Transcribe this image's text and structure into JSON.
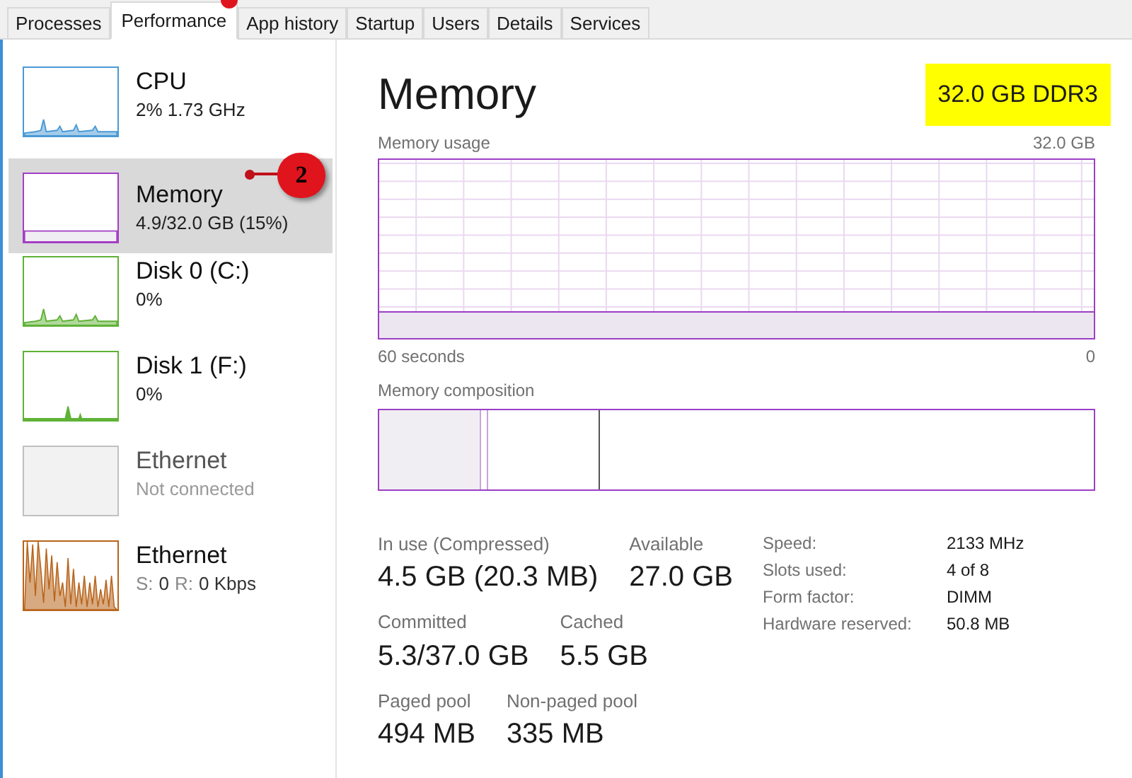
{
  "tabs": [
    {
      "label": "Processes",
      "selected": false
    },
    {
      "label": "Performance",
      "selected": true
    },
    {
      "label": "App history",
      "selected": false
    },
    {
      "label": "Startup",
      "selected": false
    },
    {
      "label": "Users",
      "selected": false
    },
    {
      "label": "Details",
      "selected": false
    },
    {
      "label": "Services",
      "selected": false
    }
  ],
  "sidebar": {
    "items": [
      {
        "kind": "spiky",
        "color": "#4a9ad6",
        "title": "CPU",
        "subtitle": "2% 1.73 GHz",
        "selected": false,
        "disabled": false
      },
      {
        "kind": "flat",
        "color": "#a33fc4",
        "title": "Memory",
        "subtitle": "4.9/32.0 GB (15%)",
        "selected": true,
        "disabled": false
      },
      {
        "kind": "spiky",
        "color": "#5fb236",
        "title": "Disk 0 (C:)",
        "subtitle": "0%",
        "selected": false,
        "disabled": false
      },
      {
        "kind": "single",
        "color": "#5fb236",
        "title": "Disk 1 (F:)",
        "subtitle": "0%",
        "selected": false,
        "disabled": false
      },
      {
        "kind": "empty",
        "color": "#c0c0c0",
        "title": "Ethernet",
        "subtitle": "Not connected",
        "selected": false,
        "disabled": true
      },
      {
        "kind": "dense",
        "color": "#b8641a",
        "title": "Ethernet",
        "details": [
          {
            "label": "S:",
            "value": "0"
          },
          {
            "label": "R:",
            "value": "0 Kbps"
          }
        ],
        "selected": false,
        "disabled": false
      }
    ]
  },
  "annotation": {
    "label": "2"
  },
  "panel": {
    "title": "Memory",
    "badge": "32.0 GB DDR3",
    "usage_graph": {
      "label": "Memory usage",
      "max": "32.0 GB",
      "time": "60 seconds",
      "min": "0"
    },
    "composition": {
      "label": "Memory composition"
    },
    "stats": [
      [
        {
          "label": "In use (Compressed)",
          "value": "4.5 GB (20.3 MB)"
        },
        {
          "label": "Available",
          "value": "27.0 GB"
        }
      ],
      [
        {
          "label": "Committed",
          "value": "5.3/37.0 GB"
        },
        {
          "label": "Cached",
          "value": "5.5 GB"
        }
      ],
      [
        {
          "label": "Paged pool",
          "value": "494 MB"
        },
        {
          "label": "Non-paged pool",
          "value": "335 MB"
        }
      ]
    ],
    "properties": [
      {
        "label": "Speed:",
        "value": "2133 MHz"
      },
      {
        "label": "Slots used:",
        "value": "4 of 8"
      },
      {
        "label": "Form factor:",
        "value": "DIMM"
      },
      {
        "label": "Hardware reserved:",
        "value": "50.8 MB"
      }
    ]
  }
}
